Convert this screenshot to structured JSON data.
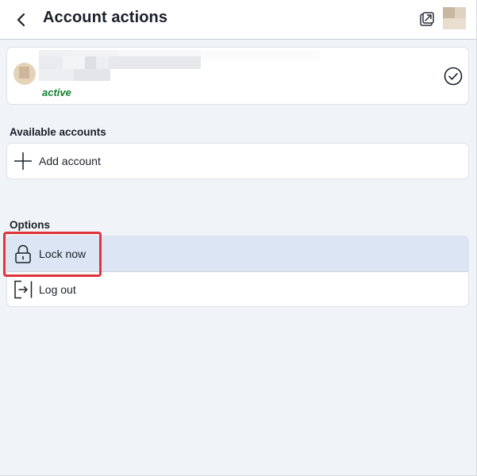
{
  "header": {
    "title": "Account actions",
    "back_icon": "chevron-left-icon",
    "popout_icon": "popout-icon"
  },
  "active_account": {
    "status": "active",
    "status_color": "#0f7f2a",
    "check_icon": "check-circle-icon"
  },
  "available_accounts": {
    "label": "Available accounts",
    "items": [
      {
        "label": "Add account",
        "icon": "plus-icon"
      }
    ]
  },
  "options": {
    "label": "Options",
    "items": [
      {
        "label": "Lock now",
        "icon": "lock-icon",
        "highlighted": true
      },
      {
        "label": "Log out",
        "icon": "logout-icon",
        "highlighted": false
      }
    ]
  },
  "colors": {
    "background": "#f0f3f7",
    "highlight": "#dbe5f4",
    "annotation": "#e0343c"
  }
}
